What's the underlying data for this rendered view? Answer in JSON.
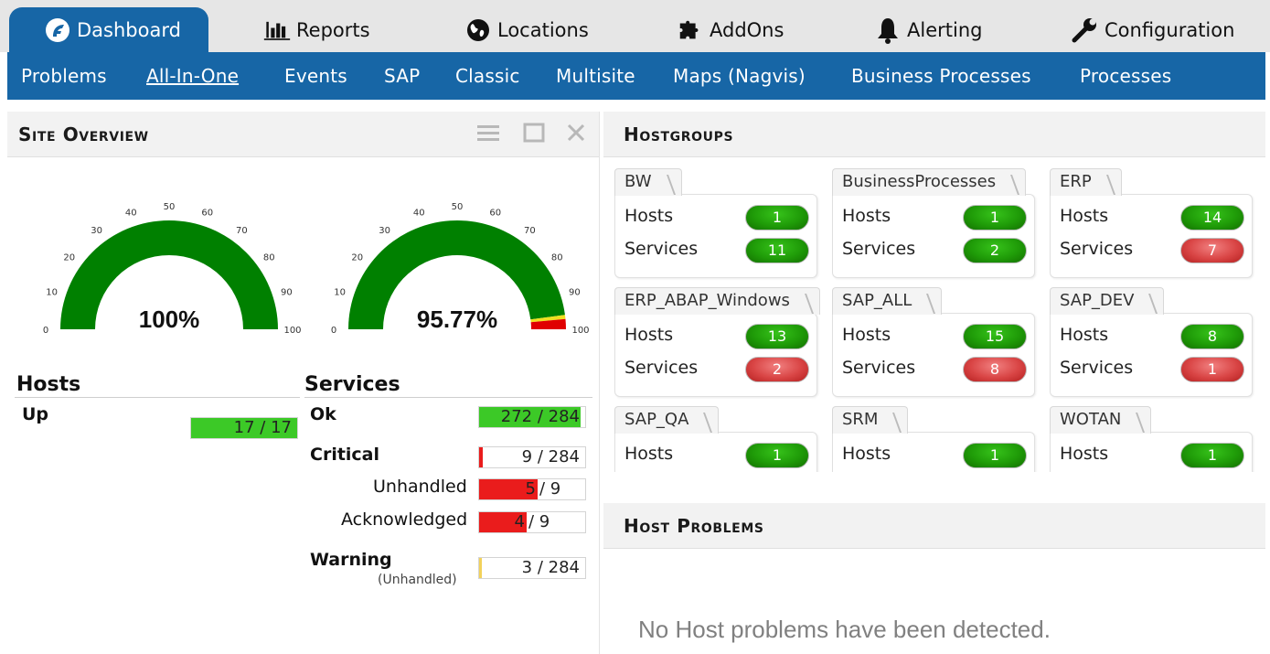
{
  "top_tabs": [
    {
      "label": "Dashboard",
      "icon": "dashboard-logo-icon",
      "active": true
    },
    {
      "label": "Reports",
      "icon": "bar-chart-icon"
    },
    {
      "label": "Locations",
      "icon": "globe-icon"
    },
    {
      "label": "AddOns",
      "icon": "puzzle-icon"
    },
    {
      "label": "Alerting",
      "icon": "bell-icon"
    },
    {
      "label": "Configuration",
      "icon": "wrench-icon"
    }
  ],
  "sub_nav": [
    "Problems",
    "All-In-One",
    "Events",
    "SAP",
    "Classic",
    "Multisite",
    "Maps (Nagvis)",
    "Business Processes",
    "Processes"
  ],
  "sub_nav_current": "All-In-One",
  "site_overview": {
    "title": "Site Overview",
    "gauges": [
      {
        "value_label": "100%",
        "percent": 100,
        "ticks": [
          "0",
          "10",
          "20",
          "30",
          "40",
          "50",
          "60",
          "70",
          "80",
          "90",
          "100"
        ]
      },
      {
        "value_label": "95.77%",
        "percent": 95.77,
        "ticks": [
          "0",
          "10",
          "20",
          "30",
          "40",
          "50",
          "60",
          "70",
          "80",
          "90",
          "100"
        ]
      }
    ],
    "hosts": {
      "heading": "Hosts",
      "rows": [
        {
          "label": "Up",
          "value": "17 / 17",
          "fraction": 1.0,
          "color": "#3cc927"
        }
      ]
    },
    "services": {
      "heading": "Services",
      "ok": {
        "label": "Ok",
        "value": "272 / 284",
        "fraction": 0.958,
        "color": "#3cc927"
      },
      "critical": {
        "label": "Critical",
        "value": "9 / 284",
        "fraction": 0.032,
        "color": "#ea1c1c"
      },
      "unhandled": {
        "label": "Unhandled",
        "num": "5",
        "den": "/ 9",
        "fraction": 0.556,
        "color": "#ea1c1c"
      },
      "acknowledged": {
        "label": "Acknowledged",
        "num": "4",
        "den": "/ 9",
        "fraction": 0.444,
        "color": "#ea1c1c"
      },
      "warning": {
        "label": "Warning",
        "sublabel": "(Unhandled)",
        "value": "3 / 284",
        "fraction": 0.011,
        "color": "#f2d25a"
      }
    }
  },
  "hostgroups": {
    "title": "Hostgroups",
    "hosts_label": "Hosts",
    "services_label": "Services",
    "groups": [
      {
        "name": "BW",
        "hosts": "1",
        "services": "11",
        "hosts_status": "green",
        "services_status": "green"
      },
      {
        "name": "BusinessProcesses",
        "hosts": "1",
        "services": "2",
        "hosts_status": "green",
        "services_status": "green"
      },
      {
        "name": "ERP",
        "hosts": "14",
        "services": "7",
        "hosts_status": "green",
        "services_status": "red"
      },
      {
        "name": "ERP_ABAP_Windows",
        "hosts": "13",
        "services": "2",
        "hosts_status": "green",
        "services_status": "red"
      },
      {
        "name": "SAP_ALL",
        "hosts": "15",
        "services": "8",
        "hosts_status": "green",
        "services_status": "red"
      },
      {
        "name": "SAP_DEV",
        "hosts": "8",
        "services": "1",
        "hosts_status": "green",
        "services_status": "red"
      },
      {
        "name": "SAP_QA",
        "hosts": "1",
        "hosts_status": "green"
      },
      {
        "name": "SRM",
        "hosts": "1",
        "hosts_status": "green"
      },
      {
        "name": "WOTAN",
        "hosts": "1",
        "hosts_status": "green"
      }
    ]
  },
  "host_problems": {
    "title": "Host Problems",
    "empty_message": "No Host problems have been detected."
  },
  "colors": {
    "brand_blue": "#1766a6",
    "gauge_green": "#008000",
    "gauge_red": "#e00000",
    "gauge_yellow": "#f0e020"
  }
}
